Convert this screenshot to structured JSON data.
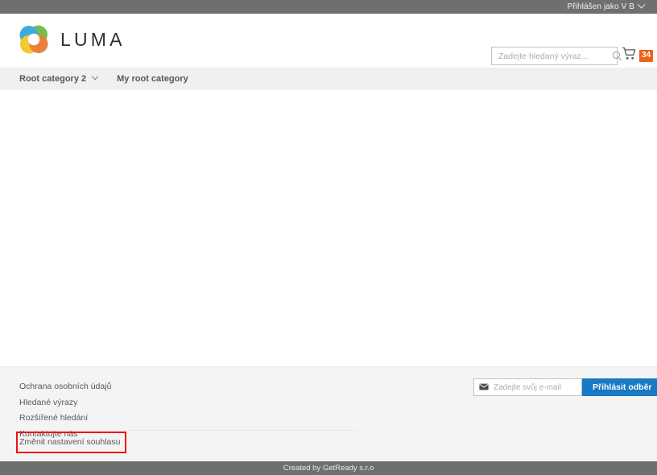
{
  "top_panel": {
    "greeting": "Přihlášen jako V B",
    "chevron_icon": "chevron-down-icon",
    "background": "#6d706e"
  },
  "header": {
    "logo_text": "LUMA",
    "logo_icon": "luma-ring-logo",
    "logo_colors": {
      "green": "#6aba3f",
      "blue": "#2da6d9",
      "yellow": "#f5c51f",
      "orange": "#e8762b"
    },
    "search": {
      "placeholder": "Zadejte hledaný výraz...",
      "value": "",
      "icon": "search-icon"
    },
    "cart": {
      "icon": "shopping-cart-icon",
      "count": "34",
      "badge_color": "#f2601a"
    }
  },
  "nav": {
    "items": [
      {
        "label": "Root category 2",
        "has_chevron": true
      },
      {
        "label": "My root category",
        "has_chevron": false
      }
    ],
    "background": "#f0f0f0"
  },
  "footer": {
    "links": [
      "Ochrana osobních údajů",
      "Hledané výrazy",
      "Rozšířené hledání",
      "Kontaktujte nás",
      "Změnit nastavení souhlasu"
    ],
    "newsletter": {
      "icon": "envelope-icon",
      "placeholder": "Zadejte svůj e-mail",
      "value": "",
      "button_label": "Přihlásit odběr",
      "button_color": "#1979c3"
    },
    "background": "#f4f4f4"
  },
  "bottom_bar": {
    "text": "Created by GetReady s.r.o",
    "background": "#6d706e"
  },
  "highlight": {
    "color": "#ee1111",
    "target": "Změnit nastavení souhlasu"
  }
}
